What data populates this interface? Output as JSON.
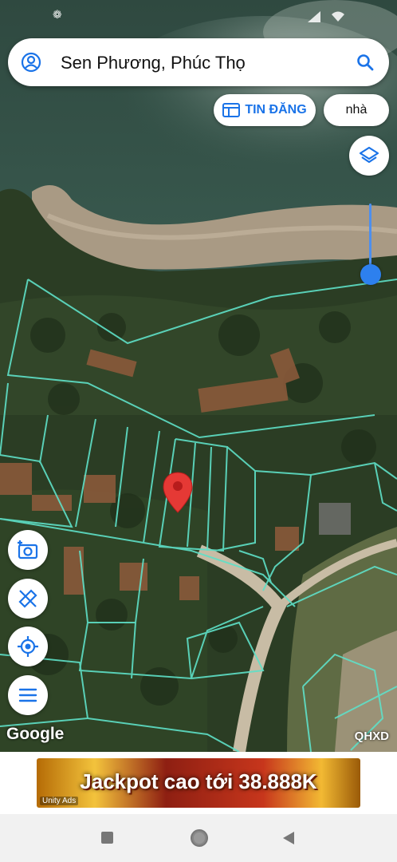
{
  "search": {
    "query": "Sen Phương, Phúc Thọ"
  },
  "chips": {
    "post_label": "TIN ĐĂNG",
    "home_label": "nhà"
  },
  "map": {
    "attribution": "Google",
    "overlay_label": "QHXD",
    "pin_color": "#e53935",
    "parcel_color": "#5fe0c8"
  },
  "ad": {
    "text": "Jackpot cao tới 38.888K",
    "badge": "Unity Ads"
  },
  "icons": {
    "user": "account-circle-icon",
    "search": "search-icon",
    "post": "listing-icon",
    "layers": "layers-icon",
    "camera": "add-photo-icon",
    "measure": "ruler-pencil-icon",
    "locate": "my-location-icon",
    "menu": "menu-icon"
  }
}
